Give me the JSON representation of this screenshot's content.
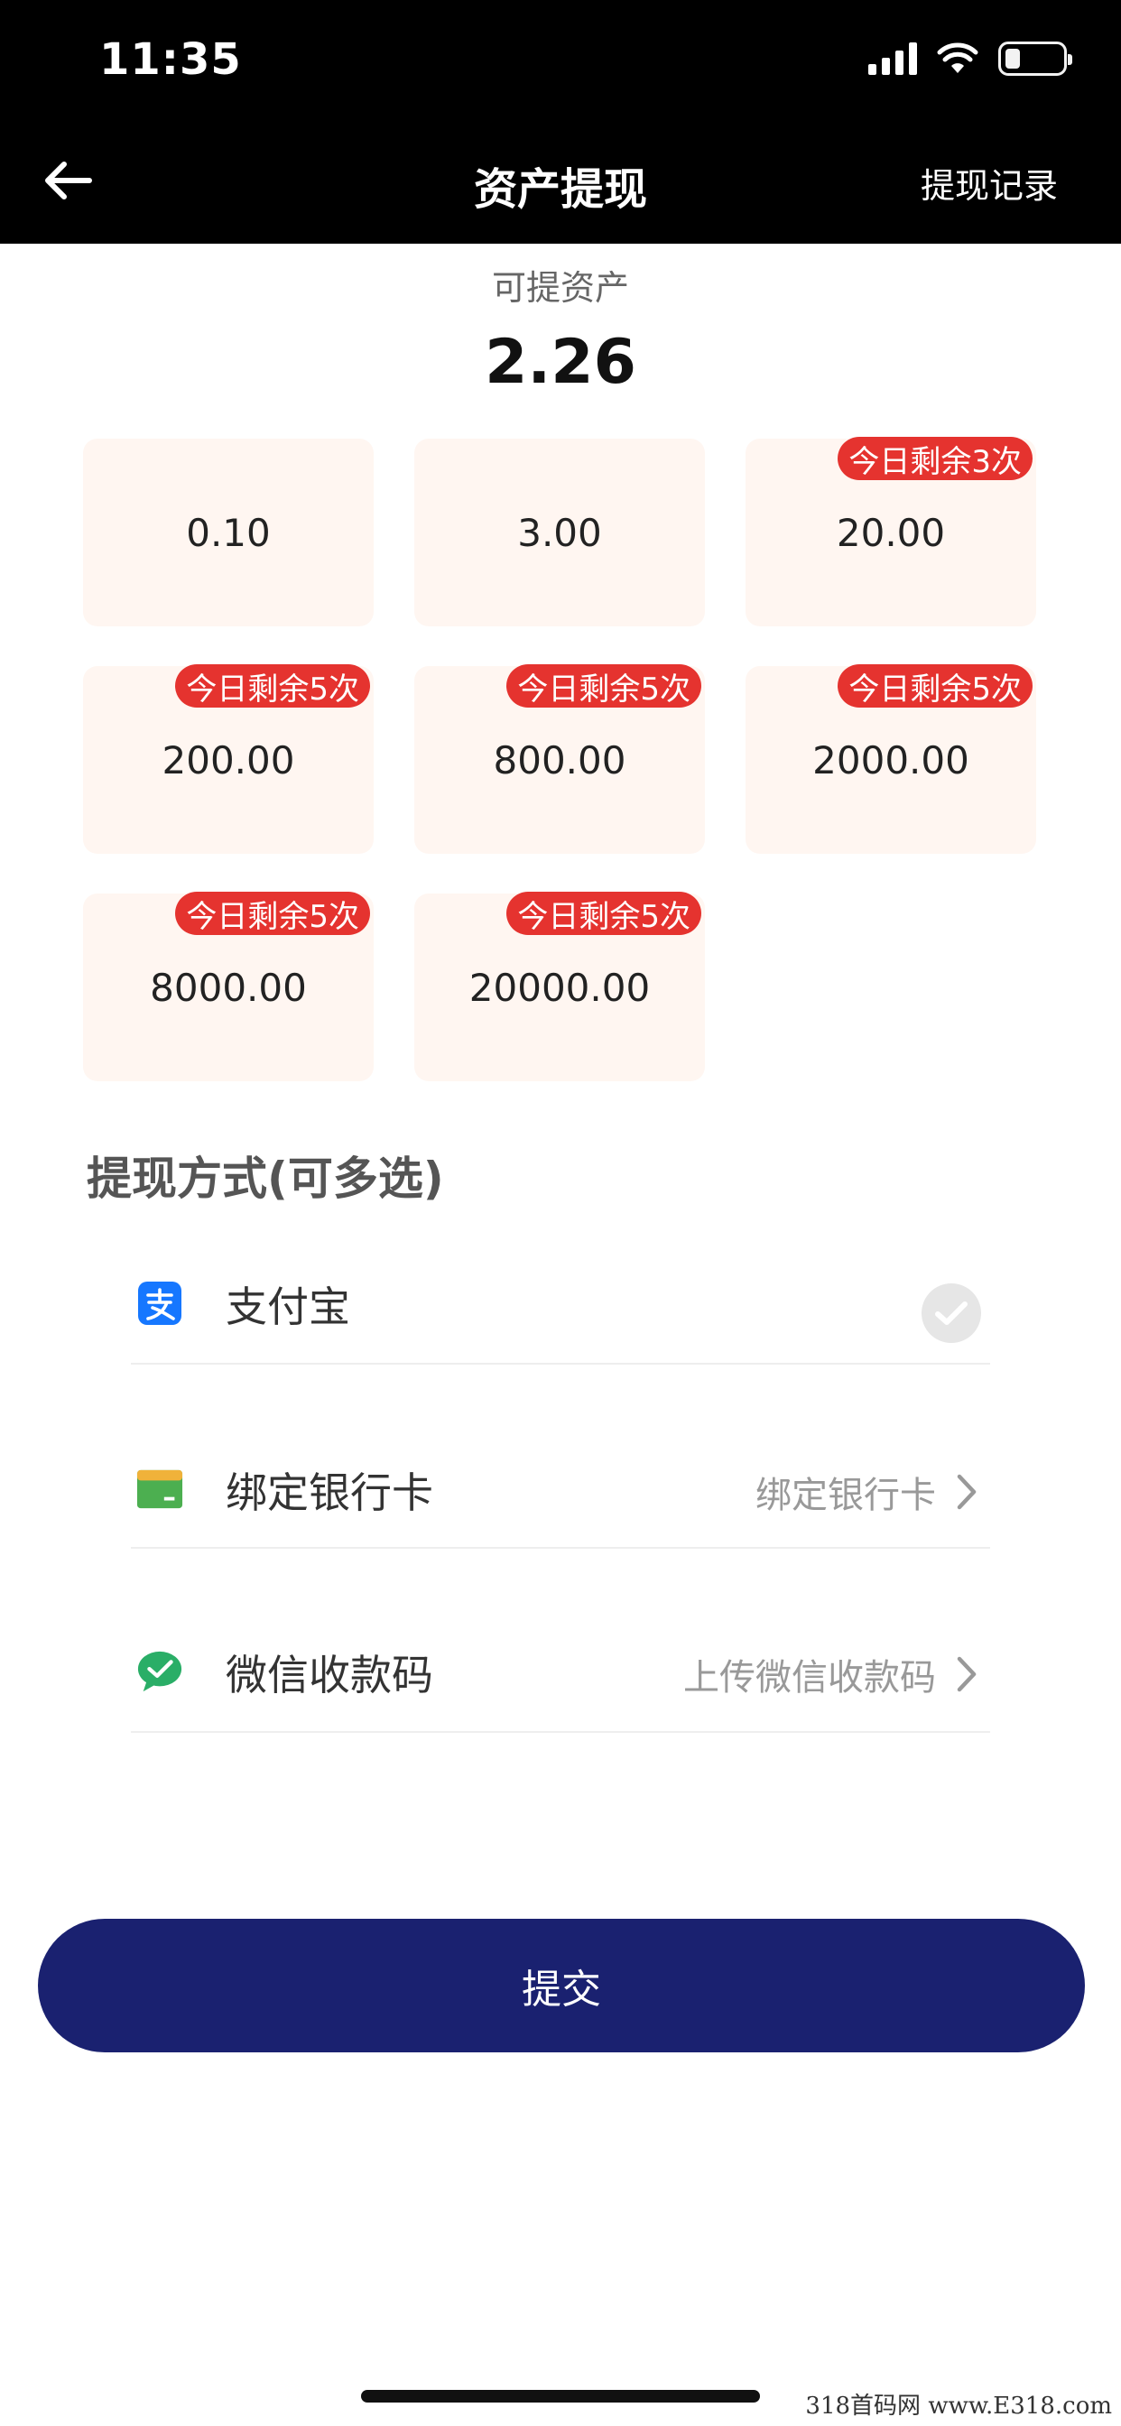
{
  "status_bar": {
    "time": "11:35"
  },
  "header": {
    "title": "资产提现",
    "right_link": "提现记录"
  },
  "asset": {
    "label": "可提资产",
    "value": "2.26"
  },
  "amounts": [
    {
      "value": "0.10",
      "badge": ""
    },
    {
      "value": "3.00",
      "badge": ""
    },
    {
      "value": "20.00",
      "badge": "今日剩余3次"
    },
    {
      "value": "200.00",
      "badge": "今日剩余5次"
    },
    {
      "value": "800.00",
      "badge": "今日剩余5次"
    },
    {
      "value": "2000.00",
      "badge": "今日剩余5次"
    },
    {
      "value": "8000.00",
      "badge": "今日剩余5次"
    },
    {
      "value": "20000.00",
      "badge": "今日剩余5次"
    }
  ],
  "methods": {
    "title": "提现方式(可多选)",
    "items": [
      {
        "label": "支付宝",
        "hint": "",
        "icon": "alipay-icon",
        "selected": true
      },
      {
        "label": "绑定银行卡",
        "hint": "绑定银行卡",
        "icon": "bank-card-icon"
      },
      {
        "label": "微信收款码",
        "hint": "上传微信收款码",
        "icon": "wechat-icon"
      }
    ]
  },
  "submit": {
    "label": "提交"
  },
  "watermark": "318首码网 www.E318.com",
  "colors": {
    "primary": "#1a2170",
    "badge": "#e5332f",
    "card_bg": "#fff6f1",
    "alipay": "#1677ff",
    "wechat": "#2aae67",
    "bank": "#4caf50"
  }
}
